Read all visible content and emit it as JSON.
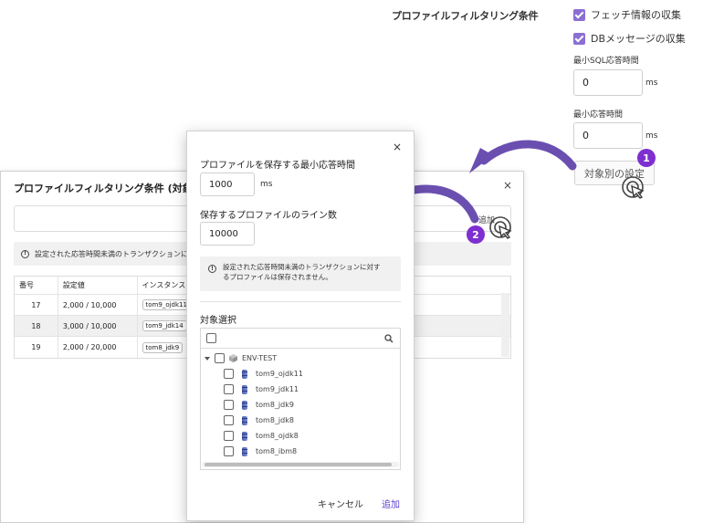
{
  "settings": {
    "title": "プロファイルフィルタリング条件",
    "fetch_info_label": "フェッチ情報の収集",
    "db_message_label": "DBメッセージの収集",
    "min_sql_label": "最小SQL応答時間",
    "min_sql_value": "0",
    "min_resp_label": "最小応答時間",
    "min_resp_value": "0",
    "unit_ms": "ms",
    "target_settings_button": "対象別の設定"
  },
  "badges": {
    "one": "1",
    "two": "2"
  },
  "background_dialog": {
    "title": "プロファイルフィルタリング条件 (対象別の",
    "close": "×",
    "add_label": "追加",
    "info_text": "設定された応答時間未満のトランザクションに対す",
    "columns": [
      "番号",
      "設定値",
      "インスタンス"
    ],
    "rows": [
      {
        "num": "17",
        "value": "2,000 / 10,000",
        "instance": "tom9_ojdk11"
      },
      {
        "num": "18",
        "value": "3,000 / 10,000",
        "instance": "tom9_jdk14"
      },
      {
        "num": "19",
        "value": "2,000 / 20,000",
        "instance": "tom8_jdk9"
      }
    ]
  },
  "modal": {
    "close": "×",
    "min_time_label": "プロファイルを保存する最小応答時間",
    "min_time_value": "1000",
    "unit_ms": "ms",
    "lines_label": "保存するプロファイルのライン数",
    "lines_value": "10000",
    "info_line1": "設定された応答時間未満のトランザクションに対す",
    "info_line2": "るプロファイルは保存されません。",
    "target_label": "対象選択",
    "tree_root": "ENV-TEST",
    "tree_items": [
      "tom9_ojdk11",
      "tom9_jdk11",
      "tom8_jdk9",
      "tom8_jdk8",
      "tom8_ojdk8",
      "tom8_ibm8"
    ],
    "cancel": "キャンセル",
    "add": "追加"
  },
  "colors": {
    "accent": "#8b6fd3",
    "badge": "#7e2fd0",
    "arrow": "#6b4fb0",
    "link": "#5b3fd0"
  },
  "icons": [
    "checkbox-checked-icon",
    "search-icon",
    "info-icon",
    "close-icon",
    "caret-down-icon",
    "cube-icon",
    "database-icon",
    "click-cursor-icon",
    "curved-arrow-icon"
  ]
}
